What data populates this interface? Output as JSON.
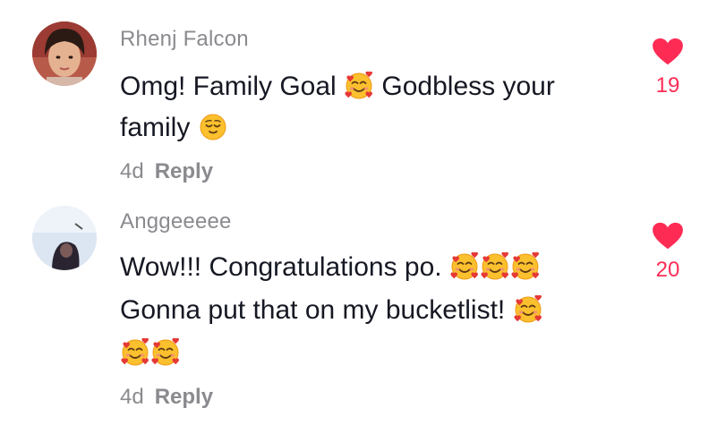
{
  "colors": {
    "accent": "#fe2c55",
    "username": "#8a8a8f",
    "text": "#161823"
  },
  "comments": [
    {
      "username": "Rhenj Falcon",
      "lines": [
        [
          "Omg! Family Goal ",
          "smiling-face-with-hearts-emoji",
          " Godbless your"
        ],
        [
          "family ",
          "relieved-face-emoji"
        ]
      ],
      "time": "4d",
      "reply_label": "Reply",
      "like_count": "19",
      "avatar_icon": "user-avatar-photo"
    },
    {
      "username": "Anggeeeee",
      "lines": [
        [
          "Wow!!! Congratulations po. ",
          "smiling-face-with-hearts-emoji x3"
        ],
        [
          "Gonna put that on my bucketlist! ",
          "smiling-face-with-hearts-emoji"
        ],
        [
          "smiling-face-with-hearts-emoji x2"
        ]
      ],
      "time": "4d",
      "reply_label": "Reply",
      "like_count": "20",
      "avatar_icon": "user-avatar-photo"
    }
  ],
  "text": {
    "c1_line1_a": "Omg! Family Goal ",
    "c1_line1_b": " Godbless your",
    "c1_line2": "family ",
    "c2_line1": "Wow!!! Congratulations po. ",
    "c2_line2": "Gonna put that on my bucketlist! "
  }
}
